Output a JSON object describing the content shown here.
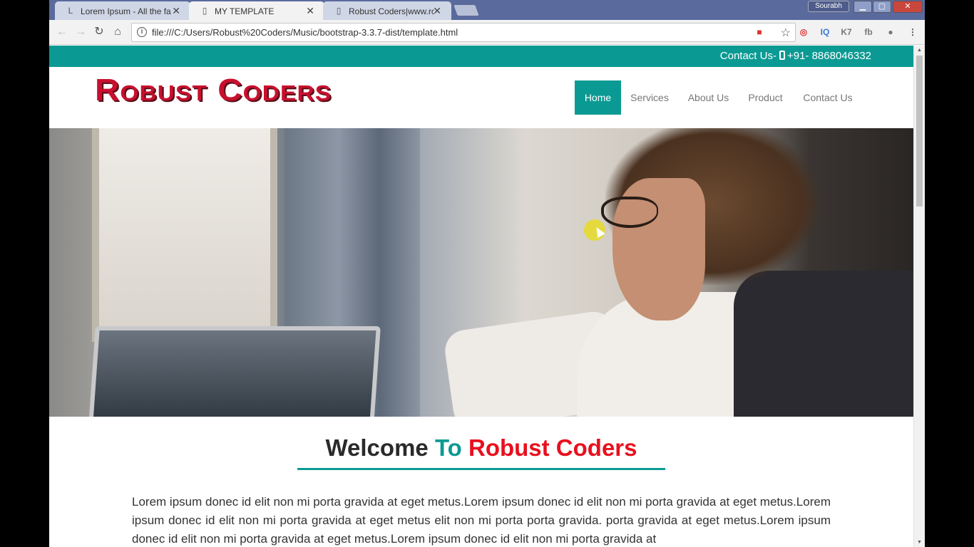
{
  "browser": {
    "tabs": [
      {
        "title": "Lorem Ipsum - All the fa",
        "icon": "L"
      },
      {
        "title": "MY TEMPLATE",
        "icon": "page"
      },
      {
        "title": "Robust Coders|www.robu",
        "icon": "page"
      }
    ],
    "profile_name": "Sourabh",
    "url": "file:///C:/Users/Robust%20Coders/Music/bootstrap-3.3.7-dist/template.html",
    "icons": [
      "back-icon",
      "forward-icon",
      "reload-icon",
      "home-icon",
      "info-icon",
      "star-icon",
      "menu-icon"
    ],
    "extensions": [
      "IQ",
      "K7",
      "fb"
    ]
  },
  "page": {
    "topbar": {
      "contact_label": "Contact Us-",
      "phone": "+91- 8868046332"
    },
    "logo": "Robust Coders",
    "nav": {
      "items": [
        "Home",
        "Services",
        "About Us",
        "Product",
        "Contact Us"
      ],
      "active": "Home"
    },
    "welcome": {
      "part1": "Welcome ",
      "part2": "To ",
      "part3": "Robust Coders"
    },
    "body_text": "Lorem ipsum donec id elit non mi porta gravida at eget metus.Lorem ipsum donec id elit non mi porta gravida at eget metus.Lorem ipsum donec id elit non mi porta gravida at eget metus elit non mi porta porta gravida. porta gravida at eget metus.Lorem ipsum donec id elit non mi porta gravida at eget metus.Lorem ipsum donec id elit non mi porta gravida at",
    "colors": {
      "accent": "#0b9a93",
      "brand_red": "#e8101e",
      "logo_red": "#c8102e"
    }
  }
}
